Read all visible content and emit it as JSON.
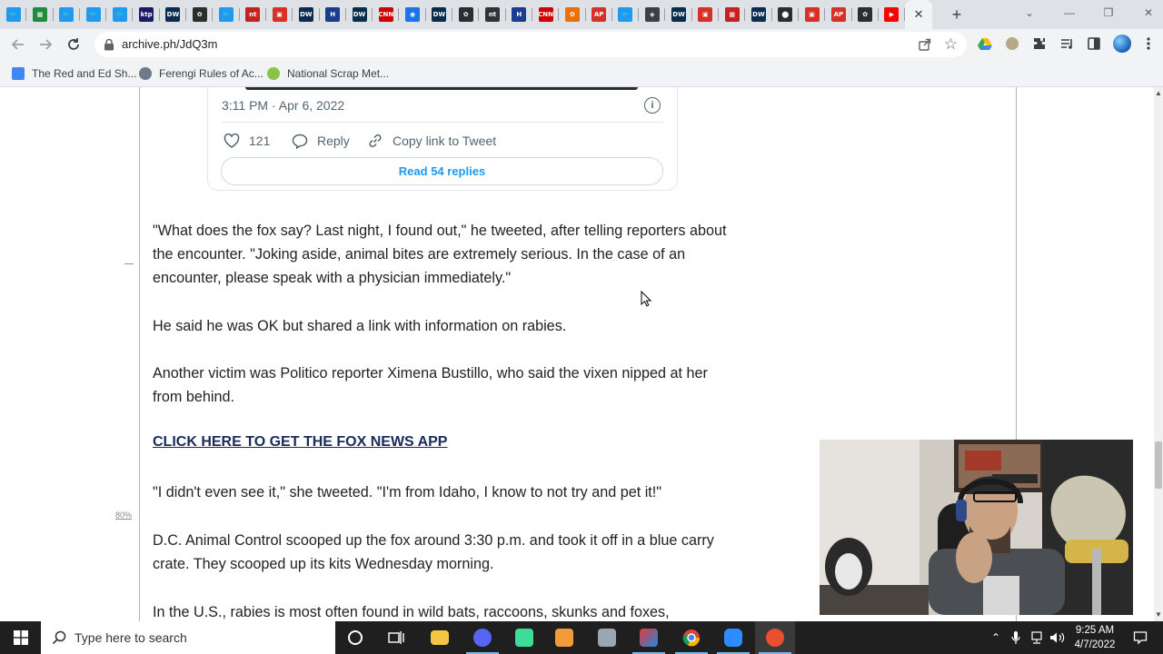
{
  "browser": {
    "tabs": [
      {
        "icon": "twitter-icon",
        "color": "#1d9bf0",
        "glyph": "🐦"
      },
      {
        "icon": "green-doc-icon",
        "color": "#1e8e3e",
        "glyph": "▦"
      },
      {
        "icon": "twitter-icon",
        "color": "#1d9bf0",
        "glyph": "🐦"
      },
      {
        "icon": "twitter-icon",
        "color": "#1d9bf0",
        "glyph": "🐦"
      },
      {
        "icon": "twitter-icon",
        "color": "#1d9bf0",
        "glyph": "🐦"
      },
      {
        "icon": "ktp-icon",
        "color": "#1a1a66",
        "glyph": "ktp"
      },
      {
        "icon": "dw-icon",
        "color": "#0a2c4f",
        "glyph": "DW"
      },
      {
        "icon": "nbc-icon",
        "color": "#2d2d2d",
        "glyph": "✿"
      },
      {
        "icon": "twitter-icon",
        "color": "#1d9bf0",
        "glyph": "🐦"
      },
      {
        "icon": "news-icon",
        "color": "#c5221f",
        "glyph": "nt"
      },
      {
        "icon": "red-square-icon",
        "color": "#d93025",
        "glyph": "▣"
      },
      {
        "icon": "dw-icon",
        "color": "#0a2c4f",
        "glyph": "DW"
      },
      {
        "icon": "h-icon",
        "color": "#1a3d8f",
        "glyph": "H"
      },
      {
        "icon": "dw-icon",
        "color": "#0a2c4f",
        "glyph": "DW"
      },
      {
        "icon": "cnn-icon",
        "color": "#cc0000",
        "glyph": "CNN"
      },
      {
        "icon": "globe-news-icon",
        "color": "#1a73e8",
        "glyph": "◉"
      },
      {
        "icon": "dw-icon",
        "color": "#0a2c4f",
        "glyph": "DW"
      },
      {
        "icon": "nbc-icon",
        "color": "#2d2d2d",
        "glyph": "✿"
      },
      {
        "icon": "news-icon",
        "color": "#333333",
        "glyph": "nt"
      },
      {
        "icon": "h-icon",
        "color": "#1a3d8f",
        "glyph": "H"
      },
      {
        "icon": "cnn-icon",
        "color": "#cc0000",
        "glyph": "CNN"
      },
      {
        "icon": "nbc-peacock-icon",
        "color": "#e8710a",
        "glyph": "✿"
      },
      {
        "icon": "ap-icon",
        "color": "#d93025",
        "glyph": "AP"
      },
      {
        "icon": "twitter-icon",
        "color": "#1d9bf0",
        "glyph": "🐦"
      },
      {
        "icon": "archive-icon",
        "color": "#3c4043",
        "glyph": "◈"
      },
      {
        "icon": "dw-icon",
        "color": "#0a2c4f",
        "glyph": "DW"
      },
      {
        "icon": "red-square-icon",
        "color": "#d93025",
        "glyph": "▣"
      },
      {
        "icon": "red-square-icon",
        "color": "#c5221f",
        "glyph": "▦"
      },
      {
        "icon": "dw-icon",
        "color": "#0a2c4f",
        "glyph": "DW"
      },
      {
        "icon": "dark-circle-icon",
        "color": "#2d2d2d",
        "glyph": "⬤"
      },
      {
        "icon": "red-square-icon",
        "color": "#d93025",
        "glyph": "▣"
      },
      {
        "icon": "ap-icon",
        "color": "#d93025",
        "glyph": "AP"
      },
      {
        "icon": "nbc-icon",
        "color": "#2d2d2d",
        "glyph": "✿"
      },
      {
        "icon": "youtube-icon",
        "color": "#ff0000",
        "glyph": "▶"
      }
    ],
    "url": "archive.ph/JdQ3m",
    "bookmarks": [
      {
        "label": "The Red and Ed Sh...",
        "icon": "doc-icon",
        "color": "#4285f4"
      },
      {
        "label": "Ferengi Rules of Ac...",
        "icon": "ferengi-icon",
        "color": "#5f6368"
      },
      {
        "label": "National Scrap Met...",
        "icon": "scrap-icon",
        "color": "#8bc34a"
      }
    ]
  },
  "tweet": {
    "timestamp": "3:11 PM · Apr 6, 2022",
    "likes": "121",
    "reply_label": "Reply",
    "copy_label": "Copy link to Tweet",
    "read_replies": "Read 54 replies"
  },
  "article": {
    "p1": "\"What does the fox say? Last night, I found out,\" he tweeted, after telling reporters about the encounter. \"Joking aside, animal bites are extremely serious. In the case of an encounter, please speak with a physician immediately.\"",
    "p2": "He said he was OK but shared a link with information on rabies.",
    "p3": "Another victim was Politico reporter Ximena Bustillo, who said the vixen nipped at her from behind.",
    "link": "CLICK HERE TO GET THE FOX NEWS APP",
    "p4": "\"I didn't even see it,\" she tweeted. \"I'm from Idaho, I know to not try and pet it!\"",
    "p5": "D.C. Animal Control scooped up the fox around 3:30 p.m. and took it off in a blue carry crate. They scooped up its kits Wednesday morning.",
    "p6": "In the U.S., rabies is most often found in wild bats, raccoons, skunks and foxes,",
    "side_pct": "80%"
  },
  "taskbar": {
    "search_placeholder": "Type here to search",
    "time": "9:25 AM",
    "date": "4/7/2022"
  }
}
